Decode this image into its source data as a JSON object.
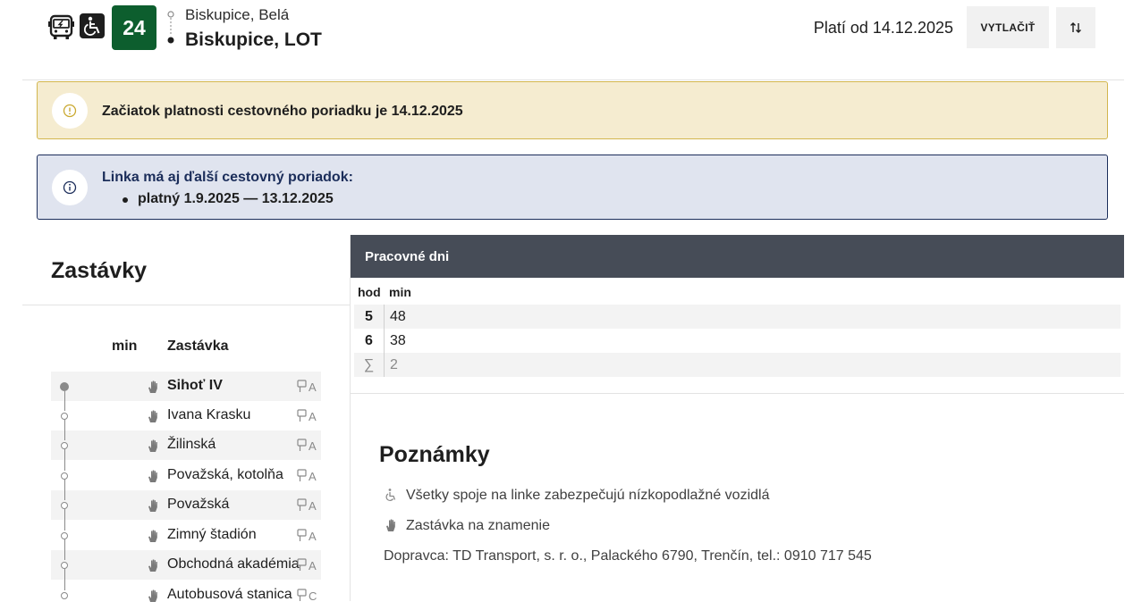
{
  "header": {
    "line_number": "24",
    "from_stop": "Biskupice, Belá",
    "to_stop": "Biskupice, LOT",
    "valid_from": "Platí od 14.12.2025",
    "print_label": "VYTLAČIŤ",
    "icons": [
      "bus-icon",
      "wheelchair-icon",
      "swap-direction-icon"
    ]
  },
  "alerts": {
    "warning": {
      "text": "Začiatok platnosti cestovného poriadku je 14.12.2025",
      "color": "#f5ecd0",
      "icon": "exclamation-circle-icon"
    },
    "info": {
      "title": "Linka má aj ďalší cestovný poriadok:",
      "item": "platný 1.9.2025 — 13.12.2025",
      "color": "#e0e4ef",
      "icon": "info-circle-icon"
    }
  },
  "stops": {
    "title": "Zastávky",
    "col_min": "min",
    "col_stop": "Zastávka",
    "items": [
      {
        "name": "Sihoť IV",
        "platform": "A"
      },
      {
        "name": "Ivana Krasku",
        "platform": "A"
      },
      {
        "name": "Žilinská",
        "platform": "A"
      },
      {
        "name": "Považská, kotolňa",
        "platform": "A"
      },
      {
        "name": "Považská",
        "platform": "A"
      },
      {
        "name": "Zimný štadión",
        "platform": "A"
      },
      {
        "name": "Obchodná akadémia",
        "platform": "A"
      },
      {
        "name": "Autobusová stanica",
        "platform": "C"
      }
    ]
  },
  "timetable": {
    "day_type": "Pracovné dni",
    "col_hour": "hod",
    "col_min": "min",
    "rows": [
      {
        "hour": "5",
        "mins": "48"
      },
      {
        "hour": "6",
        "mins": "38"
      },
      {
        "hour": "∑",
        "mins": "2"
      }
    ],
    "header_color": "#464c57"
  },
  "notes": {
    "title": "Poznámky",
    "low_floor": "Všetky spoje na linke zabezpečujú nízkopodlažné vozidlá",
    "request_stop": "Zastávka na znamenie",
    "carrier": "Dopravca: TD Transport, s. r. o., Palackého 6790, Trenčín, tel.: 0910 717 545"
  },
  "colors": {
    "line_badge": "#0d5e2e",
    "warning_border": "#d2b64e",
    "info_border": "#1b2d5a"
  }
}
